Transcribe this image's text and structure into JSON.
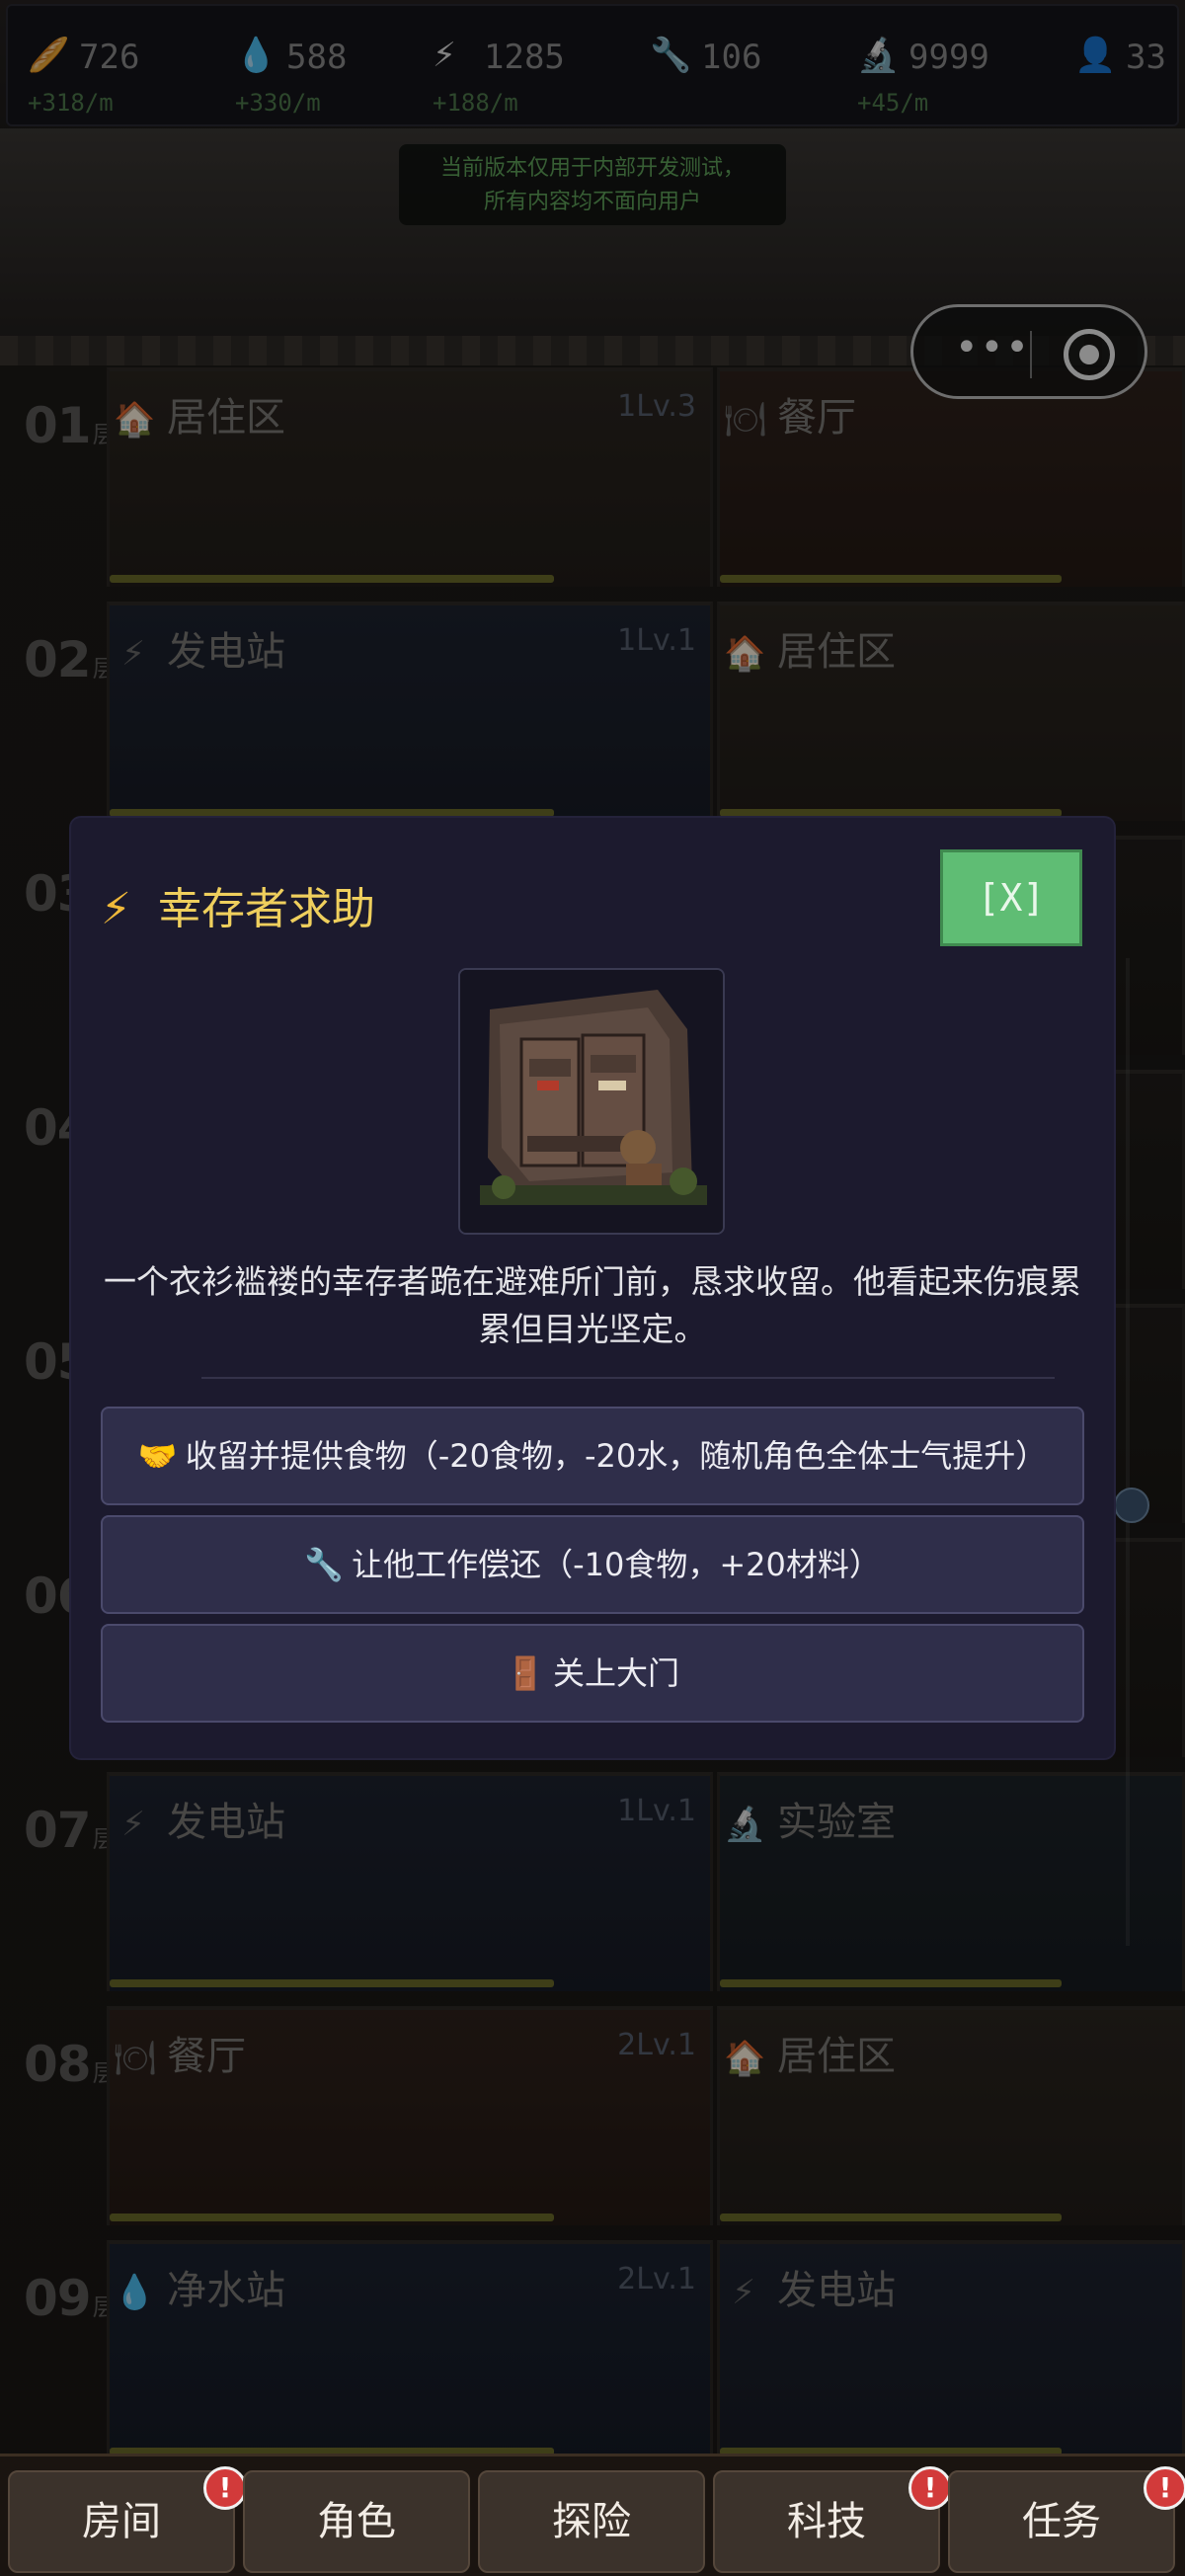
{
  "resources": [
    {
      "icon": "bread-icon",
      "glyph": "🥖",
      "value": "726",
      "rate": "+318/m",
      "color": "#8a6a3a"
    },
    {
      "icon": "water-drop-icon",
      "glyph": "💧",
      "value": "588",
      "rate": "+330/m",
      "color": "#3c6a99"
    },
    {
      "icon": "lightning-icon",
      "glyph": "⚡",
      "value": "1285",
      "rate": "+188/m",
      "color": "#8a6a22"
    },
    {
      "icon": "wrench-icon",
      "glyph": "🔧",
      "value": "106",
      "rate": "",
      "color": "#7a7a7a"
    },
    {
      "icon": "microscope-icon",
      "glyph": "🔬",
      "value": "9999",
      "rate": "+45/m",
      "color": "#3a4a6a"
    },
    {
      "icon": "people-icon",
      "glyph": "👤",
      "value": "33",
      "rate": "",
      "color": "#3a5a7a"
    }
  ],
  "notice": {
    "line1": "当前版本仅用于内部开发测试，",
    "line2": "所有内容均不面向用户"
  },
  "floors": [
    {
      "num": "01",
      "suffix": "层",
      "left": {
        "name": "居住区",
        "glyph": "🏠",
        "level": "1Lv.3",
        "type": "living"
      },
      "right": {
        "name": "餐厅",
        "glyph": "🍽",
        "type": "dining"
      }
    },
    {
      "num": "02",
      "suffix": "层",
      "left": {
        "name": "发电站",
        "glyph": "⚡",
        "level": "1Lv.1",
        "type": "power"
      },
      "right": {
        "name": "居住区",
        "glyph": "🏠",
        "type": "living"
      }
    },
    {
      "num": "03",
      "suffix": "层",
      "left": {
        "name": "",
        "glyph": "",
        "level": "",
        "type": "dark"
      },
      "right": {
        "name": "",
        "glyph": "",
        "type": "dark"
      }
    },
    {
      "num": "04",
      "suffix": "层",
      "left": {
        "name": "",
        "glyph": "",
        "level": "",
        "type": "dark"
      },
      "right": {
        "name": "",
        "glyph": "",
        "type": "dark"
      }
    },
    {
      "num": "05",
      "suffix": "层",
      "left": {
        "name": "",
        "glyph": "",
        "level": "",
        "type": "dark"
      },
      "right": {
        "name": "",
        "glyph": "",
        "type": "dark"
      }
    },
    {
      "num": "06",
      "suffix": "层",
      "left": {
        "name": "",
        "glyph": "",
        "level": "",
        "type": "dark"
      },
      "right": {
        "name": "",
        "glyph": "",
        "type": "dark"
      }
    },
    {
      "num": "07",
      "suffix": "层",
      "left": {
        "name": "发电站",
        "glyph": "⚡",
        "level": "1Lv.1",
        "type": "power"
      },
      "right": {
        "name": "实验室",
        "glyph": "🔬",
        "type": "lab"
      }
    },
    {
      "num": "08",
      "suffix": "层",
      "left": {
        "name": "餐厅",
        "glyph": "🍽",
        "level": "2Lv.1",
        "type": "dining"
      },
      "right": {
        "name": "居住区",
        "glyph": "🏠",
        "type": "living"
      }
    },
    {
      "num": "09",
      "suffix": "层",
      "left": {
        "name": "净水站",
        "glyph": "💧",
        "level": "2Lv.1",
        "type": "water"
      },
      "right": {
        "name": "发电站",
        "glyph": "⚡",
        "type": "power"
      }
    }
  ],
  "modal": {
    "title": "幸存者求助",
    "title_icon": "lightning-icon",
    "close_label": "[X]",
    "description": "一个衣衫褴褛的幸存者跪在避难所门前，恳求收留。他看起来伤痕累累但目光坚定。",
    "options": [
      {
        "icon": "handshake-icon",
        "glyph": "🤝",
        "label": "收留并提供食物（-20食物，-20水，随机角色全体士气提升）"
      },
      {
        "icon": "wrench-icon",
        "glyph": "🔧",
        "label": "让他工作偿还（-10食物，+20材料）"
      },
      {
        "icon": "door-icon",
        "glyph": "🚪",
        "label": "关上大门"
      }
    ]
  },
  "nav": [
    {
      "label": "房间",
      "badge": "!"
    },
    {
      "label": "角色",
      "badge": ""
    },
    {
      "label": "探险",
      "badge": ""
    },
    {
      "label": "科技",
      "badge": "!"
    },
    {
      "label": "任务",
      "badge": "!"
    }
  ],
  "colors": {
    "modal_bg": "#1c1a2e",
    "title_yellow": "#efcf5d",
    "close_green": "#5fbd74",
    "option_bg": "#2f2e4a",
    "badge_red": "#d23a3a",
    "notice_green": "#5fa35b"
  }
}
